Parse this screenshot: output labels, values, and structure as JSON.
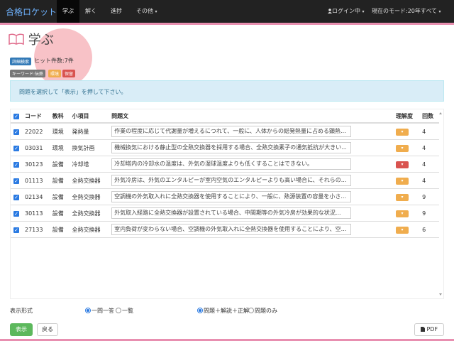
{
  "navbar": {
    "brand": "合格ロケット",
    "items": [
      "学ぶ",
      "解く",
      "進捗",
      "その他"
    ],
    "caret": "▾",
    "login": "ログイン中",
    "mode": "現在のモード:20年すべて"
  },
  "page": {
    "title": "学ぶ"
  },
  "filters": {
    "detail_badge": "詳細検索",
    "hits_text": "ヒット件数:7件",
    "keyword_badge": "キーワード:伝熱",
    "tag1": "環境",
    "tag2": "保留"
  },
  "alert": {
    "text": "問題を選択して「表示」を押して下さい。"
  },
  "table": {
    "headers": [
      "コード",
      "教科",
      "小項目",
      "問題文",
      "理解度",
      "回数"
    ],
    "check": "✓",
    "dropdown_caret": "▾",
    "rows": [
      {
        "code": "22022",
        "subject": "環境",
        "item": "発熱量",
        "text": "作業の程度に応じて代謝量が増えるにつれて、一般に、人体からの総発熱量に占める顕熱...",
        "level": "orange",
        "count": "4"
      },
      {
        "code": "03031",
        "subject": "環境",
        "item": "換気計画",
        "text": "機械換気における静止型の全熱交換器を採用する場合、全熱交換素子の通気抵抗が大きい...",
        "level": "orange",
        "count": "4"
      },
      {
        "code": "30123",
        "subject": "設備",
        "item": "冷却塔",
        "text": "冷却塔内の冷却水の温度は、外気の湿球温度よりも低くすることはできない。",
        "level": "red",
        "count": "4"
      },
      {
        "code": "01113",
        "subject": "設備",
        "item": "全熱交換器",
        "text": "外気冷房は、外気のエンタルピーが室内空気のエンタルピーよりも高い場合に、それらの...",
        "level": "orange",
        "count": "4"
      },
      {
        "code": "02134",
        "subject": "設備",
        "item": "全熱交換器",
        "text": "空調機の外気取入れに全熱交換器を使用することにより、一般に、熱源装置の容量を小さ...",
        "level": "orange",
        "count": "9"
      },
      {
        "code": "30113",
        "subject": "設備",
        "item": "全熱交換器",
        "text": "外気取入経路に全熱交換器が設置されている場合、中間期等の外気冷房が効果的な状況...",
        "level": "orange",
        "count": "9"
      },
      {
        "code": "27133",
        "subject": "設備",
        "item": "全熱交換器",
        "text": "室内負荷が変わらない場合、空調機の外気取入れに全熱交換器を使用することにより、空...",
        "level": "orange",
        "count": "6"
      }
    ]
  },
  "colors": {
    "orange": "#f0ad4e",
    "red": "#d9534f",
    "blue": "#337ab7",
    "gray": "#777",
    "green": "#5cb85c"
  },
  "display": {
    "label": "表示形式",
    "opt1": "一問一答",
    "opt2": "一覧",
    "opt3": "問題＋解説＋正解",
    "opt4": "問題のみ"
  },
  "buttons": {
    "show": "表示",
    "back": "戻る",
    "pdf": "PDF"
  },
  "icons": {
    "user": "user-icon",
    "book": "book-icon",
    "pdf": "file-icon"
  }
}
